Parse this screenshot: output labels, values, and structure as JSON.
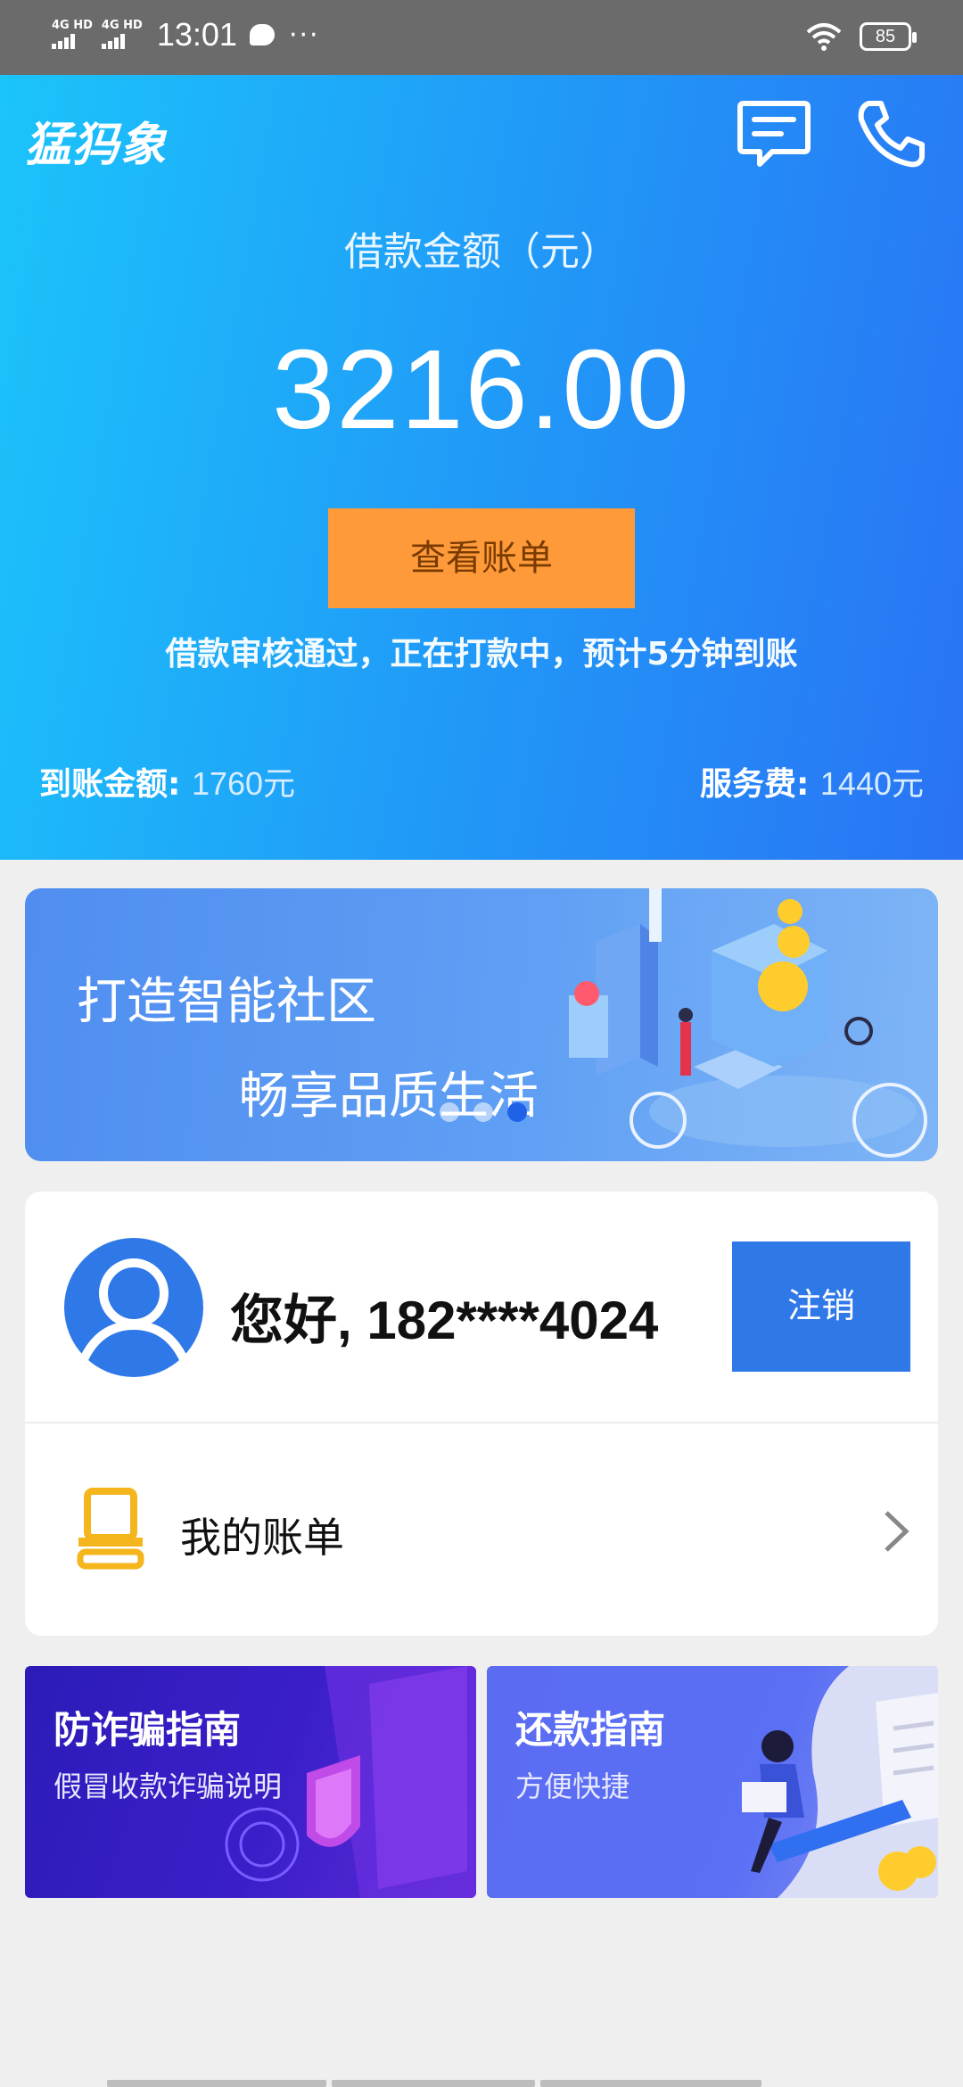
{
  "status_bar": {
    "net1": "4G HD",
    "net2": "4G HD",
    "time": "13:01",
    "battery": "85"
  },
  "header": {
    "brand": "猛犸象",
    "message_icon": "message-icon",
    "phone_icon": "phone-icon"
  },
  "loan": {
    "label": "借款金额（元）",
    "amount": "3216.00",
    "view_bill_label": "查看账单",
    "status_message": "借款审核通过，正在打款中，预计5分钟到账",
    "received_label": "到账金额:",
    "received_value": "1760元",
    "fee_label": "服务费:",
    "fee_value": "1440元"
  },
  "banner": {
    "line1": "打造智能社区",
    "line2": "畅享品质生活",
    "pages": 3,
    "active_page": 3
  },
  "user": {
    "greeting": "您好, 182****4024",
    "logout_label": "注销"
  },
  "menu": {
    "my_bill_label": "我的账单"
  },
  "guides": [
    {
      "title": "防诈骗指南",
      "subtitle": "假冒收款诈骗说明"
    },
    {
      "title": "还款指南",
      "subtitle": "方便快捷"
    }
  ],
  "colors": {
    "hero_start": "#1bc4fb",
    "hero_end": "#2a73f4",
    "bill_button": "#fe9a3a",
    "logout_button": "#2f78e8",
    "bill_icon": "#f5b51c",
    "anti_fraud_bg": "#3a1fc9",
    "repay_bg": "#5a6ff4"
  }
}
